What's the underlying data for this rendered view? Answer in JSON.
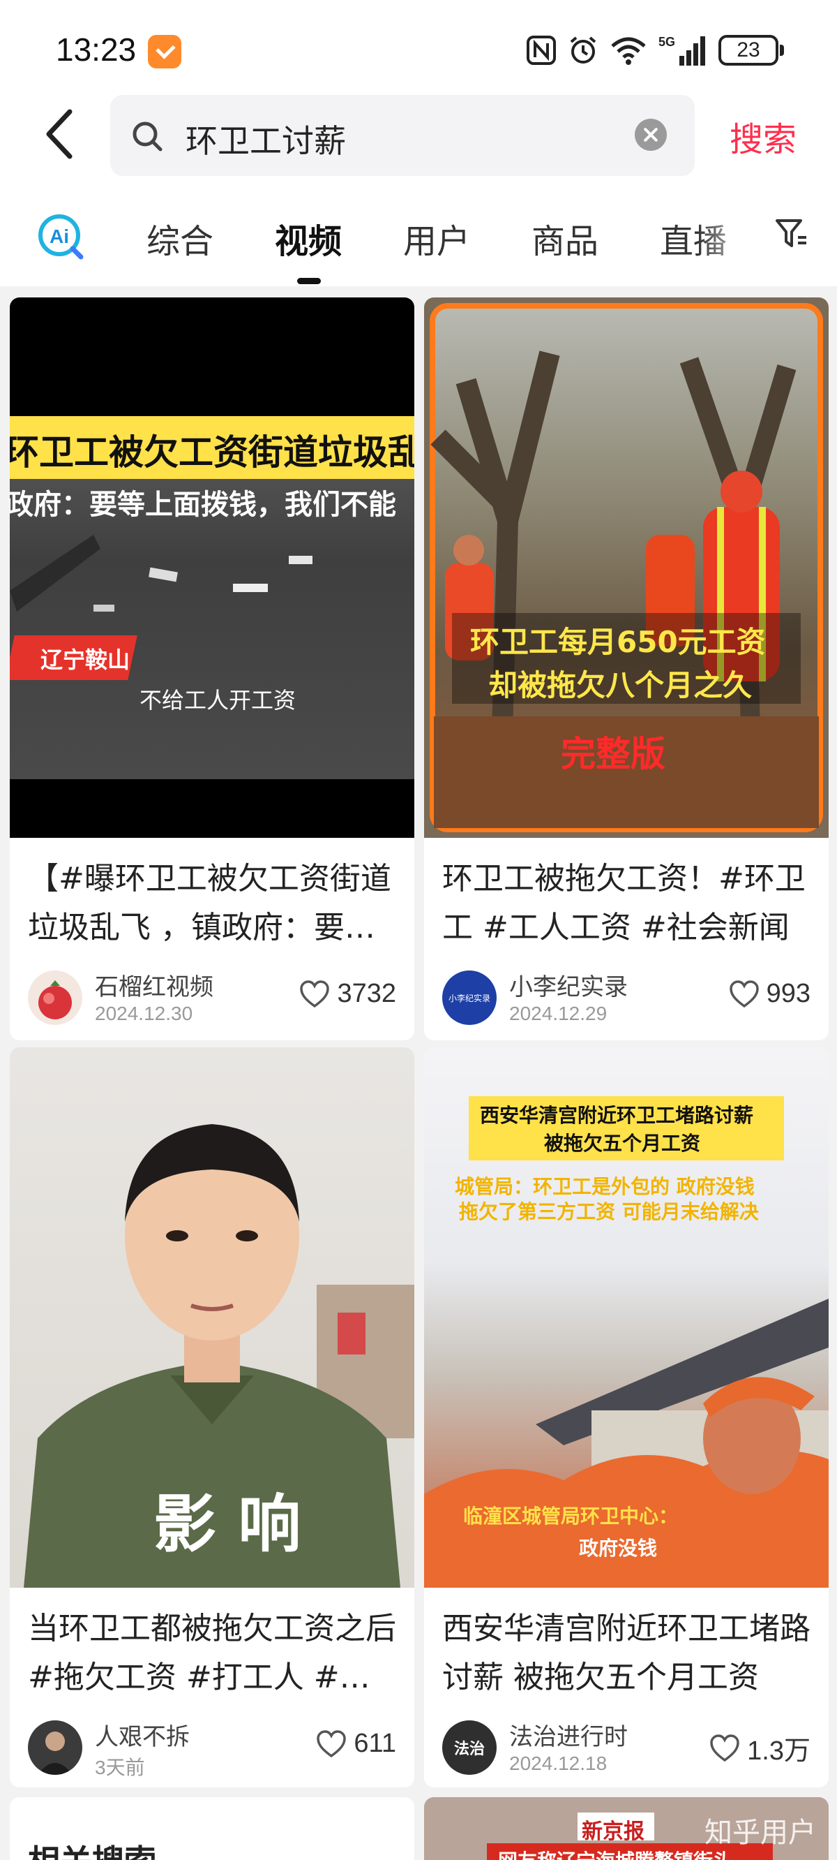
{
  "status_bar": {
    "time": "13:23",
    "network": "5G",
    "battery": "23"
  },
  "search": {
    "query": "环卫工讨薪",
    "submit_label": "搜索"
  },
  "tabs": [
    {
      "label": "综合"
    },
    {
      "label": "视频",
      "active": true
    },
    {
      "label": "用户"
    },
    {
      "label": "商品"
    },
    {
      "label": "直播"
    }
  ],
  "ai_label": "Ai",
  "cards": [
    {
      "thumb": {
        "banner_line1": "环卫工被欠工资街道垃圾乱",
        "banner_line2": "政府：要等上面拨钱，我们不能",
        "location_tag": "辽宁鞍山",
        "subtitle": "不给工人开工资"
      },
      "title": "【#曝环卫工被欠工资街道垃圾乱飞 ，镇政府：要等上面拨钱",
      "author": "石榴红视频",
      "date": "2024.12.30",
      "likes": "3732"
    },
    {
      "thumb": {
        "caption_line1": "环卫工每月650元工资",
        "caption_line2": "却被拖欠八个月之久",
        "caption_line3": "完整版"
      },
      "title": "环卫工被拖欠工资！#环卫工 #工人工资 #社会新闻",
      "author": "小李纪实录",
      "avatar_text": "小李纪实录",
      "date": "2024.12.29",
      "likes": "993"
    },
    {
      "thumb": {
        "overlay": "影 响"
      },
      "title": "当环卫工都被拖欠工资之后#拖欠工资 #打工人 #环卫工",
      "author": "人艰不拆",
      "date": "3天前",
      "likes": "611"
    },
    {
      "thumb": {
        "headline_line1": "西安华清宫附近环卫工堵路讨薪",
        "headline_line2": "被拖欠五个月工资",
        "sub_line1": "城管局：环卫工是外包的  政府没钱",
        "sub_line2": "拖欠了第三方工资  可能月末给解决",
        "bottom_line1": "临潼区城管局环卫中心：",
        "bottom_line2": "政府没钱"
      },
      "title": "西安华清宫附近环卫工堵路讨薪 被拖欠五个月工资",
      "author": "法治进行时",
      "avatar_text": "法治",
      "date": "2024.12.18",
      "likes": "1.3万"
    }
  ],
  "bottom_partial": {
    "related_title": "相关搜索",
    "news_tag": "新京报",
    "news_line": "网友称辽宁海城腾鳌镇街头",
    "watermark": "知乎用户"
  },
  "colors": {
    "accent": "#ff2e4d",
    "card_bg": "#ffffff",
    "page_bg": "#f2f2f2",
    "banner_yellow": "#ffe14a"
  }
}
